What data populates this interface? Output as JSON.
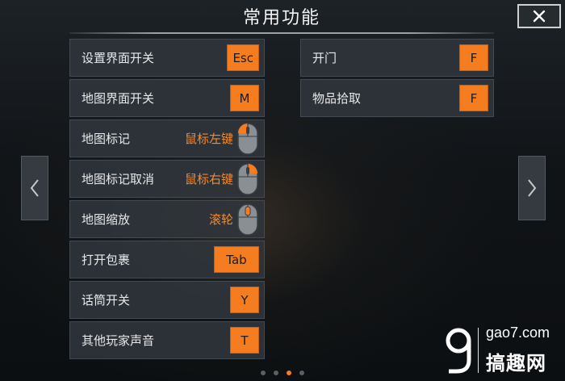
{
  "header": {
    "title": "常用功能"
  },
  "close": {
    "icon": "close-icon"
  },
  "left_column": [
    {
      "label": "设置界面开关",
      "key": "Esc"
    },
    {
      "label": "地图界面开关",
      "key": "M"
    },
    {
      "label": "地图标记",
      "mouse": "鼠标左键",
      "mouse_highlight": "left"
    },
    {
      "label": "地图标记取消",
      "mouse": "鼠标右键",
      "mouse_highlight": "right"
    },
    {
      "label": "地图缩放",
      "mouse": "滚轮",
      "mouse_highlight": "wheel"
    },
    {
      "label": "打开包裹",
      "key": "Tab"
    },
    {
      "label": "话筒开关",
      "key": "Y"
    },
    {
      "label": "其他玩家声音",
      "key": "T"
    }
  ],
  "right_column": [
    {
      "label": "开门",
      "key": "F"
    },
    {
      "label": "物品拾取",
      "key": "F"
    }
  ],
  "pager": {
    "count": 4,
    "active": 2
  },
  "watermark": {
    "domain": "gao7.com",
    "brand": "搞趣网"
  },
  "colors": {
    "accent": "#f57c1f",
    "panel": "#30363c",
    "text": "#e8e8e8"
  }
}
